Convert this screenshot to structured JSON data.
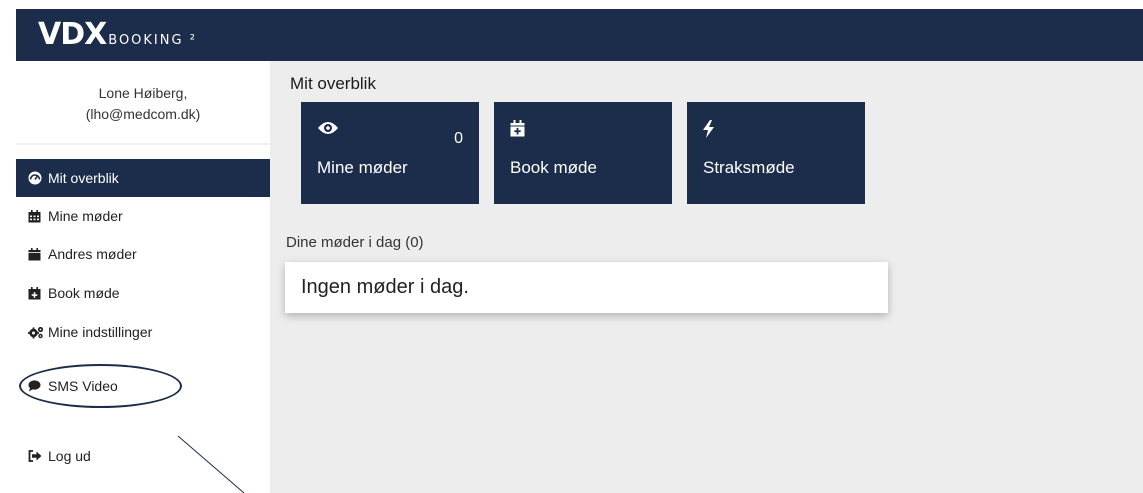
{
  "brand": {
    "logo_main": "VDX",
    "logo_sub": "BOOKING ²"
  },
  "user": {
    "name": "Lone Høiberg,",
    "email": "(lho@medcom.dk)"
  },
  "sidebar": {
    "items": [
      {
        "label": "Mit overblik",
        "icon": "dashboard-icon"
      },
      {
        "label": "Mine møder",
        "icon": "calendar-grid-icon"
      },
      {
        "label": "Andres møder",
        "icon": "calendar-icon"
      },
      {
        "label": "Book møde",
        "icon": "calendar-plus-icon"
      },
      {
        "label": "Mine indstillinger",
        "icon": "cogs-icon"
      },
      {
        "label": "SMS Video",
        "icon": "speech-bubble-icon"
      },
      {
        "label": "Log ud",
        "icon": "sign-out-icon"
      }
    ]
  },
  "main": {
    "title": "Mit overblik",
    "cards": [
      {
        "label": "Mine møder",
        "count": "0",
        "icon": "eye-icon"
      },
      {
        "label": "Book møde",
        "icon": "calendar-plus-icon"
      },
      {
        "label": "Straksmøde",
        "icon": "bolt-icon"
      }
    ],
    "today_label": "Dine møder i dag (0)",
    "empty_message": "Ingen møder i dag."
  },
  "colors": {
    "navy": "#1b2d4b",
    "content_bg": "#ededed"
  }
}
